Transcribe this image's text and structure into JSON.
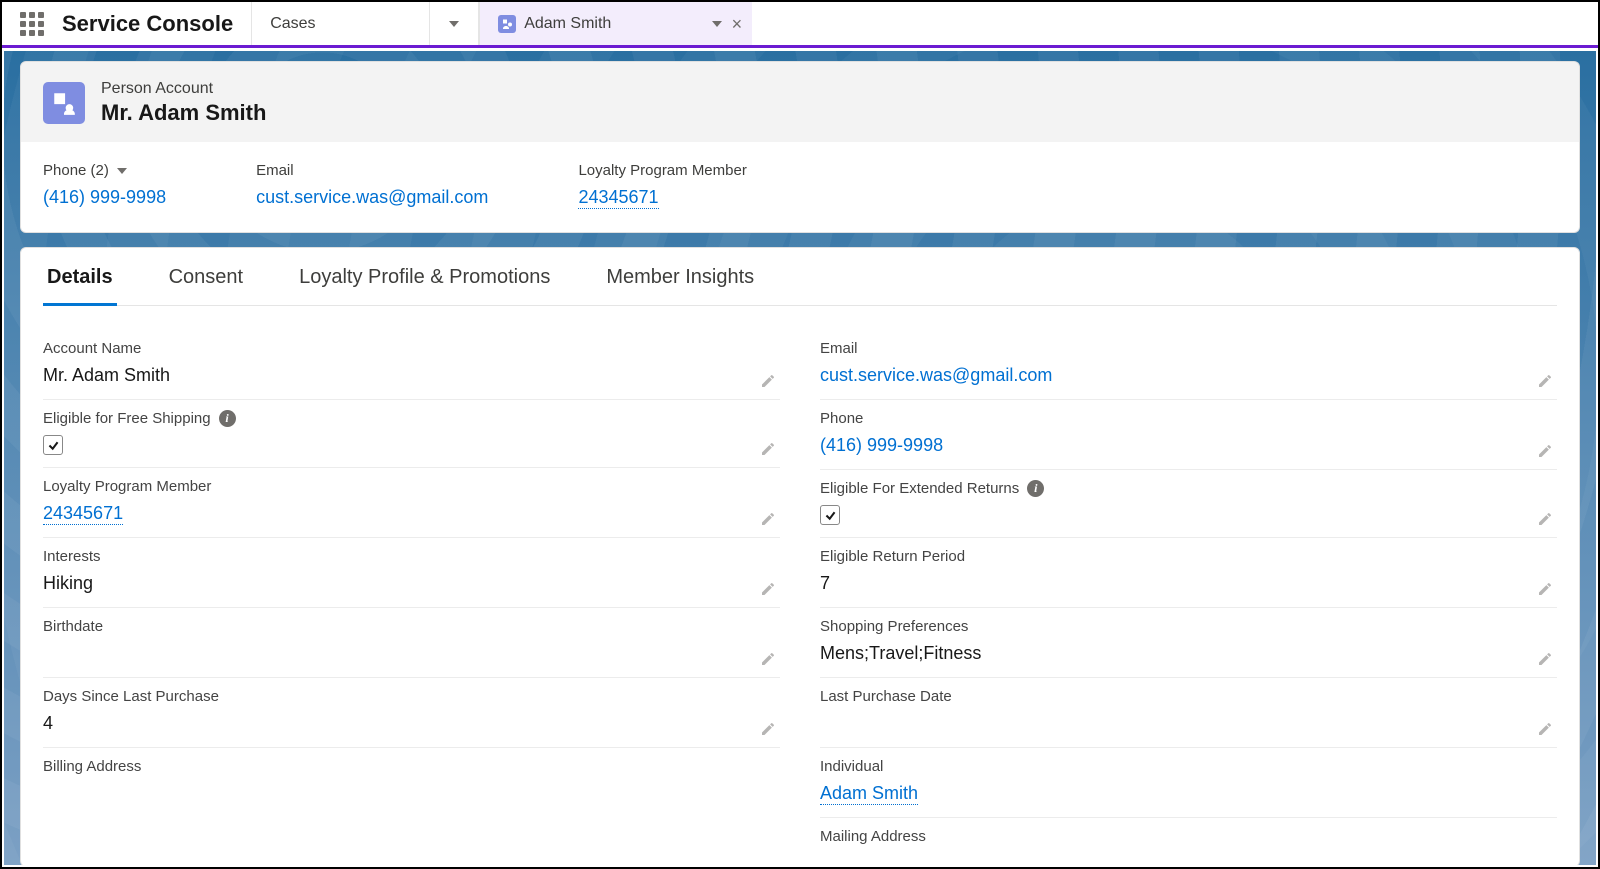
{
  "app": {
    "title": "Service Console",
    "nav_primary": "Cases",
    "subtab": {
      "label": "Adam Smith"
    }
  },
  "header": {
    "entity_label": "Person Account",
    "entity_title": "Mr. Adam Smith"
  },
  "highlights": {
    "phone": {
      "label": "Phone (2)",
      "value": "(416) 999-9998"
    },
    "email": {
      "label": "Email",
      "value": "cust.service.was@gmail.com"
    },
    "loyalty": {
      "label": "Loyalty Program Member",
      "value": "24345671"
    }
  },
  "tabs": [
    "Details",
    "Consent",
    "Loyalty Profile & Promotions",
    "Member Insights"
  ],
  "active_tab": "Details",
  "details": {
    "left": {
      "account_name": {
        "label": "Account Name",
        "value": "Mr. Adam Smith"
      },
      "free_ship": {
        "label": "Eligible for Free Shipping",
        "checked": true
      },
      "loyalty_member": {
        "label": "Loyalty Program Member",
        "value": "24345671"
      },
      "interests": {
        "label": "Interests",
        "value": "Hiking"
      },
      "birthdate": {
        "label": "Birthdate",
        "value": ""
      },
      "days_since": {
        "label": "Days Since Last Purchase",
        "value": "4"
      },
      "billing_addr": {
        "label": "Billing Address"
      }
    },
    "right": {
      "email": {
        "label": "Email",
        "value": "cust.service.was@gmail.com"
      },
      "phone": {
        "label": "Phone",
        "value": "(416) 999-9998"
      },
      "ext_returns": {
        "label": "Eligible For Extended Returns",
        "checked": true
      },
      "return_period": {
        "label": "Eligible Return Period",
        "value": "7"
      },
      "shopping_prefs": {
        "label": "Shopping Preferences",
        "value": "Mens;Travel;Fitness"
      },
      "last_purchase": {
        "label": "Last Purchase Date",
        "value": ""
      },
      "individual": {
        "label": "Individual",
        "value": "Adam Smith"
      },
      "mailing_addr": {
        "label": "Mailing Address"
      }
    }
  }
}
